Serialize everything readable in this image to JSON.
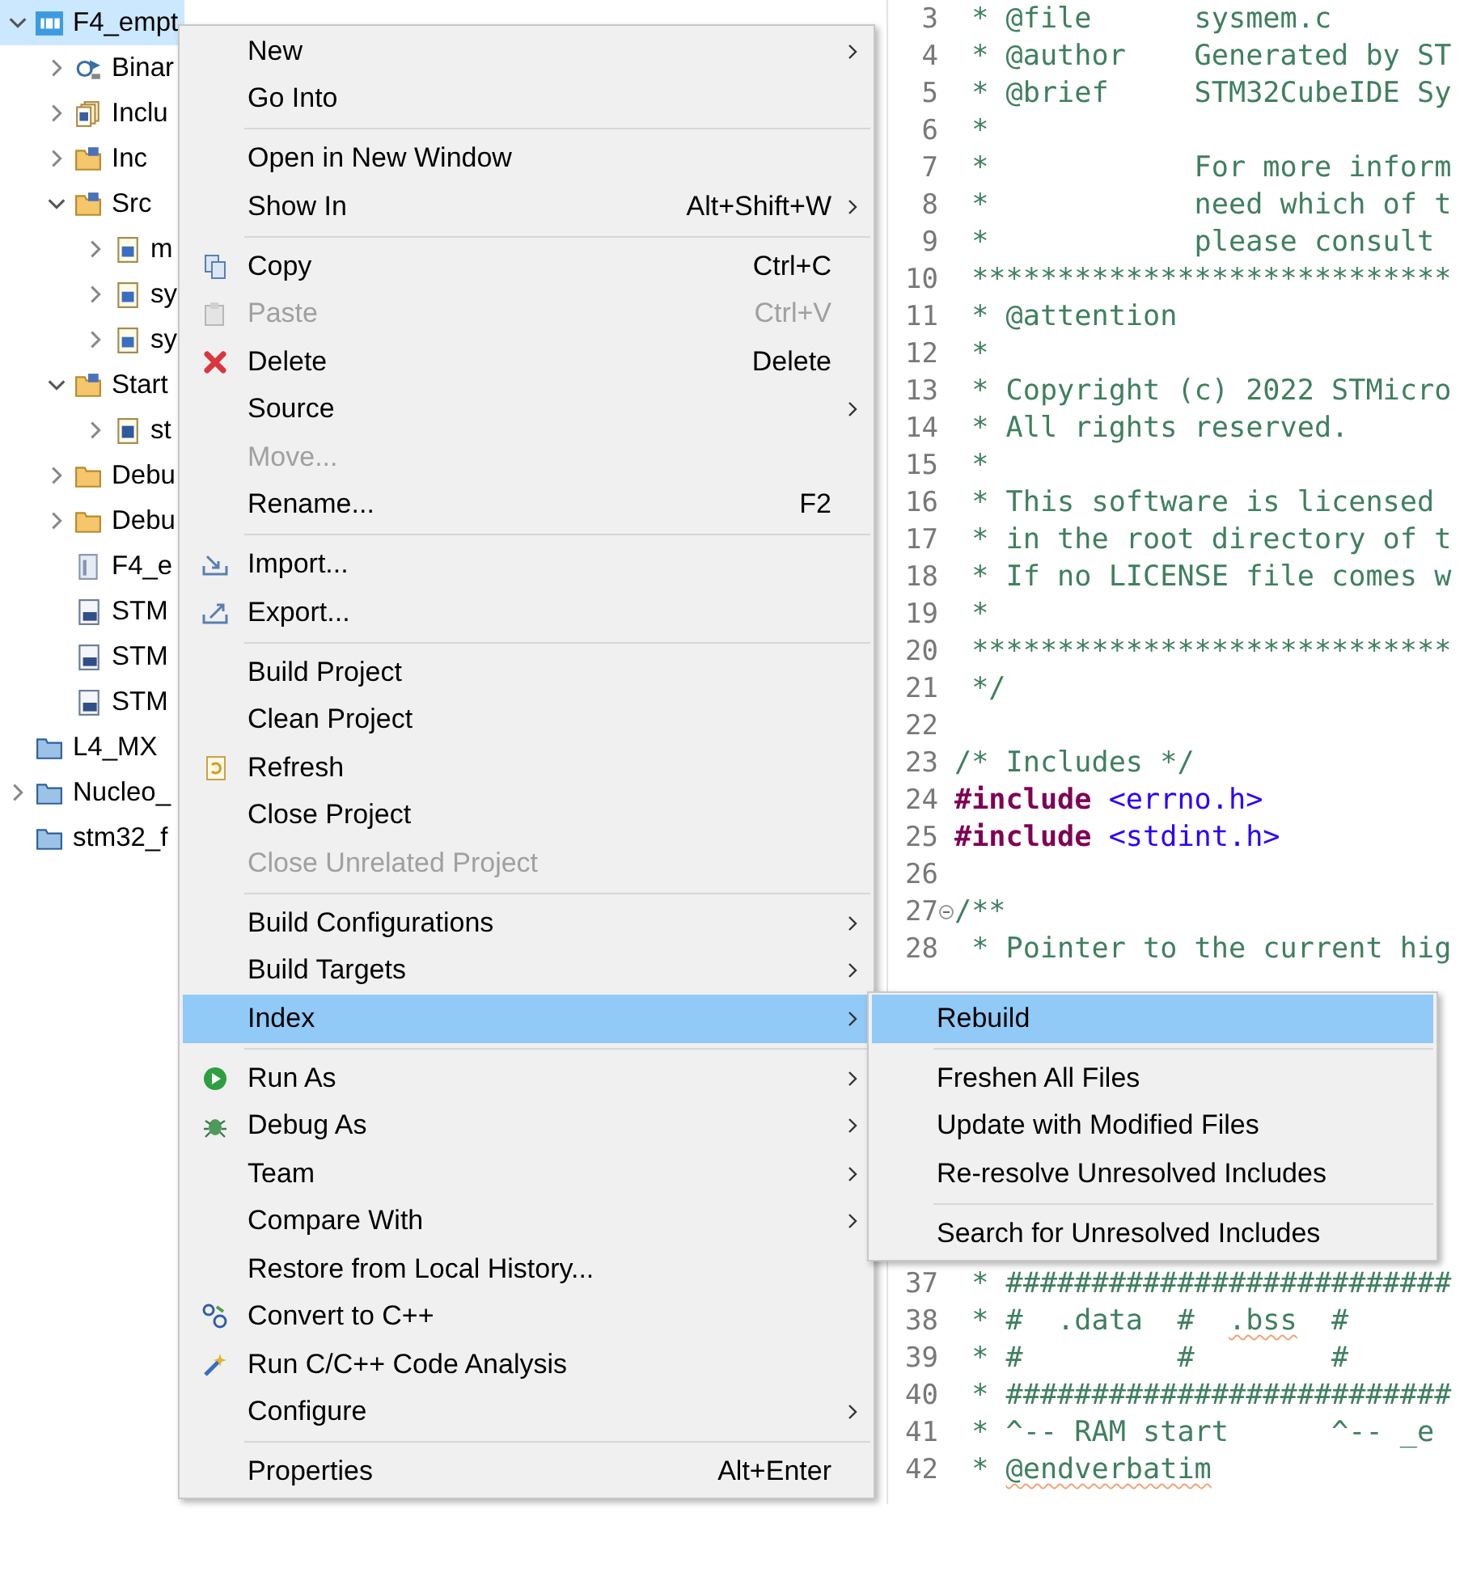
{
  "project_tree": [
    {
      "label": "F4_empt",
      "kind": "project",
      "expanded": true,
      "selected": true,
      "children": [
        {
          "label": "Binar",
          "kind": "binaries",
          "expanded": false,
          "selected": false
        },
        {
          "label": "Inclu",
          "kind": "includes",
          "expanded": false,
          "selected": false
        },
        {
          "label": "Inc",
          "kind": "source-folder",
          "expanded": false,
          "selected": false
        },
        {
          "label": "Src",
          "kind": "source-folder",
          "expanded": true,
          "selected": false,
          "children": [
            {
              "label": "m",
              "kind": "c-file",
              "expanded": false,
              "selected": false
            },
            {
              "label": "sy",
              "kind": "c-file",
              "expanded": false,
              "selected": false
            },
            {
              "label": "sy",
              "kind": "c-file",
              "expanded": false,
              "selected": false
            }
          ]
        },
        {
          "label": "Start",
          "kind": "source-folder",
          "expanded": true,
          "selected": false,
          "children": [
            {
              "label": "st",
              "kind": "asm-file",
              "expanded": false,
              "selected": false
            }
          ]
        },
        {
          "label": "Debu",
          "kind": "folder",
          "expanded": false,
          "selected": false
        },
        {
          "label": "Debu",
          "kind": "folder",
          "expanded": false,
          "selected": false
        },
        {
          "label": "F4_e",
          "kind": "file",
          "selected": false
        },
        {
          "label": "STM",
          "kind": "ld-file",
          "selected": false
        },
        {
          "label": "STM",
          "kind": "ld-file",
          "selected": false
        },
        {
          "label": "STM",
          "kind": "ld-file",
          "selected": false
        }
      ]
    },
    {
      "label": "L4_MX",
      "kind": "closed-project",
      "selected": false
    },
    {
      "label": "Nucleo_",
      "kind": "closed-project",
      "expanded": false,
      "selected": false
    },
    {
      "label": "stm32_f",
      "kind": "closed-project",
      "selected": false
    }
  ],
  "editor": {
    "lines": [
      {
        "num": "3",
        "segments": [
          {
            "kind": "comment",
            "text": " * @file      sysmem.c"
          }
        ]
      },
      {
        "num": "4",
        "segments": [
          {
            "kind": "comment",
            "text": " * @author    Generated by ST"
          }
        ]
      },
      {
        "num": "5",
        "segments": [
          {
            "kind": "comment",
            "text": " * @brief     STM32CubeIDE Sy"
          }
        ]
      },
      {
        "num": "6",
        "segments": [
          {
            "kind": "comment",
            "text": " *"
          }
        ]
      },
      {
        "num": "7",
        "segments": [
          {
            "kind": "comment",
            "text": " *            For more inform"
          }
        ]
      },
      {
        "num": "8",
        "segments": [
          {
            "kind": "comment",
            "text": " *            need which of t"
          }
        ]
      },
      {
        "num": "9",
        "segments": [
          {
            "kind": "comment",
            "text": " *            please consult"
          }
        ]
      },
      {
        "num": "10",
        "segments": [
          {
            "kind": "comment",
            "text": " ****************************"
          }
        ]
      },
      {
        "num": "11",
        "segments": [
          {
            "kind": "comment",
            "text": " * @attention"
          }
        ]
      },
      {
        "num": "12",
        "segments": [
          {
            "kind": "comment",
            "text": " *"
          }
        ]
      },
      {
        "num": "13",
        "segments": [
          {
            "kind": "comment",
            "text": " * Copyright (c) 2022 STMicro"
          }
        ]
      },
      {
        "num": "14",
        "segments": [
          {
            "kind": "comment",
            "text": " * All rights reserved."
          }
        ]
      },
      {
        "num": "15",
        "segments": [
          {
            "kind": "comment",
            "text": " *"
          }
        ]
      },
      {
        "num": "16",
        "segments": [
          {
            "kind": "comment",
            "text": " * This software is licensed"
          }
        ]
      },
      {
        "num": "17",
        "segments": [
          {
            "kind": "comment",
            "text": " * in the root directory of t"
          }
        ]
      },
      {
        "num": "18",
        "segments": [
          {
            "kind": "comment",
            "text": " * If no LICENSE file comes w"
          }
        ]
      },
      {
        "num": "19",
        "segments": [
          {
            "kind": "comment",
            "text": " *"
          }
        ]
      },
      {
        "num": "20",
        "segments": [
          {
            "kind": "comment",
            "text": " ****************************"
          }
        ]
      },
      {
        "num": "21",
        "segments": [
          {
            "kind": "comment",
            "text": " */"
          }
        ]
      },
      {
        "num": "22"
      },
      {
        "num": "23",
        "segments": [
          {
            "kind": "comment",
            "text": "/* Includes */"
          }
        ]
      },
      {
        "num": "24",
        "segments": [
          {
            "kind": "keyword",
            "text": "#include"
          },
          {
            "kind": "string",
            "text": "<errno.h>"
          }
        ]
      },
      {
        "num": "25",
        "segments": [
          {
            "kind": "keyword",
            "text": "#include"
          },
          {
            "kind": "string",
            "text": "<stdint.h>"
          }
        ]
      },
      {
        "num": "26"
      },
      {
        "num": "27",
        "folded": false,
        "segments": [
          {
            "kind": "comment",
            "text": "/**"
          }
        ]
      },
      {
        "num": "28",
        "segments": [
          {
            "kind": "comment",
            "text": " * Pointer to the current hig"
          }
        ]
      },
      {
        "num": "37",
        "segments": [
          {
            "kind": "comment",
            "text": " * ##########################"
          }
        ]
      },
      {
        "num": "38",
        "segments": [
          {
            "kind": "comment",
            "text": " * #  .data  #  "
          },
          {
            "kind": "misspelled",
            "text": ".bss"
          },
          {
            "kind": "comment",
            "text": "  #"
          }
        ]
      },
      {
        "num": "39",
        "segments": [
          {
            "kind": "comment",
            "text": " * #         #        #"
          }
        ]
      },
      {
        "num": "40",
        "segments": [
          {
            "kind": "comment",
            "text": " * ##########################"
          }
        ]
      },
      {
        "num": "41",
        "segments": [
          {
            "kind": "comment",
            "text": " * ^-- RAM start      ^-- _e"
          }
        ]
      },
      {
        "num": "42",
        "segments": [
          {
            "kind": "comment",
            "text": " * "
          },
          {
            "kind": "misspelled",
            "text": "@endverbatim"
          }
        ]
      }
    ]
  },
  "context_menu": [
    {
      "kind": "plain",
      "label": "New",
      "submenu": true,
      "disabled": false,
      "selected": false
    },
    {
      "kind": "plain",
      "label": "Go Into",
      "submenu": false,
      "disabled": false,
      "selected": false
    },
    {
      "kind": "separator"
    },
    {
      "kind": "plain",
      "label": "Open in New Window",
      "submenu": false,
      "disabled": false,
      "selected": false
    },
    {
      "kind": "plain",
      "label": "Show In",
      "shortcut": "Alt+Shift+W",
      "submenu": true,
      "disabled": false,
      "selected": false
    },
    {
      "kind": "separator"
    },
    {
      "kind": "copy",
      "label": "Copy",
      "shortcut": "Ctrl+C",
      "submenu": false,
      "disabled": false,
      "selected": false
    },
    {
      "kind": "paste",
      "label": "Paste",
      "shortcut": "Ctrl+V",
      "submenu": false,
      "disabled": true,
      "selected": false
    },
    {
      "kind": "delete",
      "label": "Delete",
      "shortcut": "Delete",
      "submenu": false,
      "disabled": false,
      "selected": false
    },
    {
      "kind": "plain",
      "label": "Source",
      "submenu": true,
      "disabled": false,
      "selected": false
    },
    {
      "kind": "plain",
      "label": "Move...",
      "submenu": false,
      "disabled": true,
      "selected": false
    },
    {
      "kind": "plain",
      "label": "Rename...",
      "shortcut": "F2",
      "submenu": false,
      "disabled": false,
      "selected": false
    },
    {
      "kind": "separator"
    },
    {
      "kind": "import",
      "label": "Import...",
      "submenu": false,
      "disabled": false,
      "selected": false
    },
    {
      "kind": "export",
      "label": "Export...",
      "submenu": false,
      "disabled": false,
      "selected": false
    },
    {
      "kind": "separator"
    },
    {
      "kind": "plain",
      "label": "Build Project",
      "submenu": false,
      "disabled": false,
      "selected": false
    },
    {
      "kind": "plain",
      "label": "Clean Project",
      "submenu": false,
      "disabled": false,
      "selected": false
    },
    {
      "kind": "refresh",
      "label": "Refresh",
      "submenu": false,
      "disabled": false,
      "selected": false
    },
    {
      "kind": "plain",
      "label": "Close Project",
      "submenu": false,
      "disabled": false,
      "selected": false
    },
    {
      "kind": "plain",
      "label": "Close Unrelated Project",
      "submenu": false,
      "disabled": true,
      "selected": false
    },
    {
      "kind": "separator"
    },
    {
      "kind": "plain",
      "label": "Build Configurations",
      "submenu": true,
      "disabled": false,
      "selected": false
    },
    {
      "kind": "plain",
      "label": "Build Targets",
      "submenu": true,
      "disabled": false,
      "selected": false
    },
    {
      "kind": "plain",
      "label": "Index",
      "submenu": true,
      "disabled": false,
      "selected": true,
      "children": [
        {
          "kind": "plain",
          "label": "Rebuild",
          "submenu": false,
          "disabled": false,
          "selected": true
        },
        {
          "kind": "separator"
        },
        {
          "kind": "plain",
          "label": "Freshen All Files",
          "submenu": false,
          "disabled": false,
          "selected": false
        },
        {
          "kind": "plain",
          "label": "Update with Modified Files",
          "submenu": false,
          "disabled": false,
          "selected": false
        },
        {
          "kind": "plain",
          "label": "Re-resolve Unresolved Includes",
          "submenu": false,
          "disabled": false,
          "selected": false
        },
        {
          "kind": "separator"
        },
        {
          "kind": "plain",
          "label": "Search for Unresolved Includes",
          "submenu": false,
          "disabled": false,
          "selected": false
        }
      ]
    },
    {
      "kind": "separator"
    },
    {
      "kind": "run",
      "label": "Run As",
      "submenu": true,
      "disabled": false,
      "selected": false
    },
    {
      "kind": "debug",
      "label": "Debug As",
      "submenu": true,
      "disabled": false,
      "selected": false
    },
    {
      "kind": "plain",
      "label": "Team",
      "submenu": true,
      "disabled": false,
      "selected": false
    },
    {
      "kind": "plain",
      "label": "Compare With",
      "submenu": true,
      "disabled": false,
      "selected": false
    },
    {
      "kind": "plain",
      "label": "Restore from Local History...",
      "submenu": false,
      "disabled": false,
      "selected": false
    },
    {
      "kind": "convert",
      "label": "Convert to C++",
      "submenu": false,
      "disabled": false,
      "selected": false
    },
    {
      "kind": "analysis",
      "label": "Run C/C++ Code Analysis",
      "submenu": false,
      "disabled": false,
      "selected": false
    },
    {
      "kind": "plain",
      "label": "Configure",
      "submenu": true,
      "disabled": false,
      "selected": false
    },
    {
      "kind": "separator"
    },
    {
      "kind": "plain",
      "label": "Properties",
      "shortcut": "Alt+Enter",
      "submenu": false,
      "disabled": false,
      "selected": false
    }
  ]
}
